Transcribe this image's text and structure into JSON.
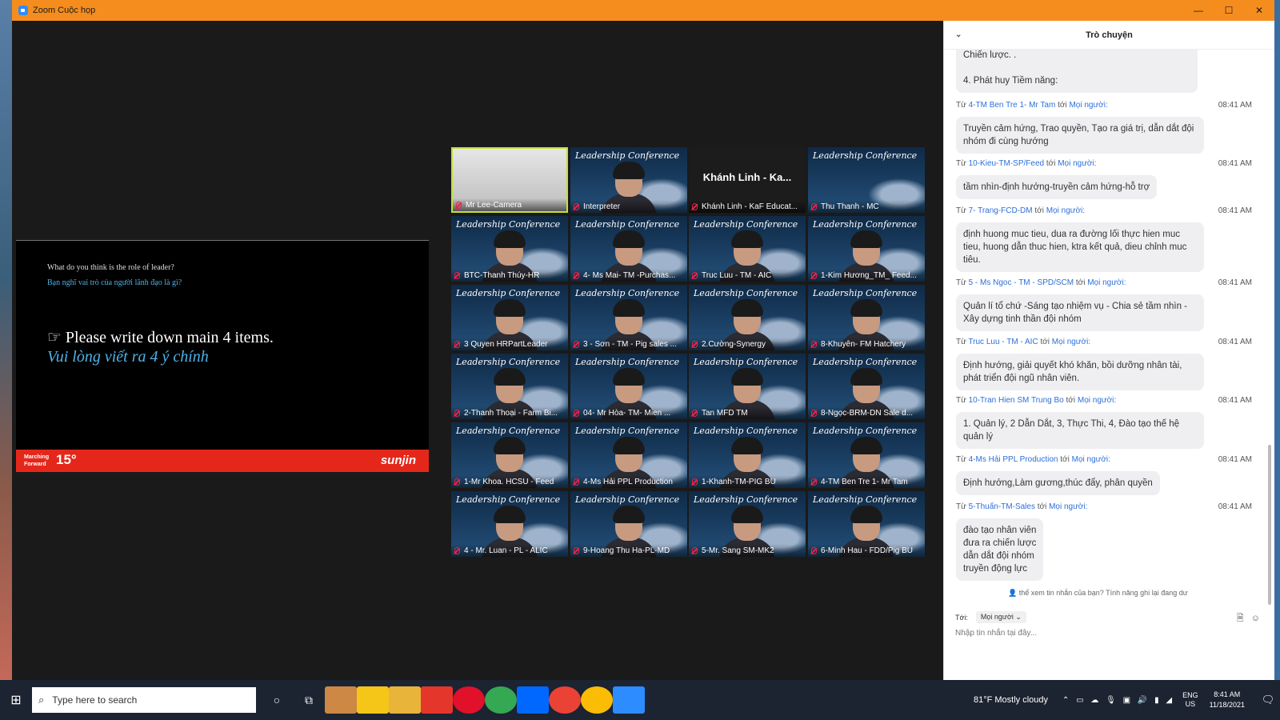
{
  "window": {
    "title": "Zoom Cuộc họp",
    "controls": [
      "—",
      "☐",
      "✕"
    ]
  },
  "slide": {
    "question_en": "What do you think is the role of leader?",
    "question_vi": "Bạn nghĩ vai trò của người lãnh đạo là gì?",
    "instruction_en": "☞ Please write down main 4 items.",
    "instruction_vi": "Vui lòng viết ra 4 ý chính",
    "footer_left": "Marching Forward",
    "footer_num": "15°",
    "footer_brand": "sunjin"
  },
  "tile_caption": "Leadership Conference",
  "participants": [
    {
      "name": "Mr Lee-Camera",
      "type": "active"
    },
    {
      "name": "Interpreter",
      "type": "video"
    },
    {
      "name": "Khánh Linh - KaF Educat...",
      "type": "black",
      "center": "Khánh Linh - Ka..."
    },
    {
      "name": "Thu Thanh - MC",
      "type": "bg"
    },
    {
      "name": "BTC-Thanh Thúy-HR",
      "type": "video"
    },
    {
      "name": "4- Ms Mai- TM -Purchas...",
      "type": "video"
    },
    {
      "name": "Truc Luu - TM - AIC",
      "type": "video"
    },
    {
      "name": "1-Kim Hương_TM_ Feed...",
      "type": "video"
    },
    {
      "name": "3 Quyen HRPartLeader",
      "type": "video"
    },
    {
      "name": "3 - Sơn - TM - Pig sales ...",
      "type": "video"
    },
    {
      "name": "2.Cường-Synergy",
      "type": "video"
    },
    {
      "name": "8-Khuyên- FM Hatchery",
      "type": "video"
    },
    {
      "name": "2-Thanh Thoại - Farm Bi...",
      "type": "video"
    },
    {
      "name": "04- Mr Hòa- TM- Mien ...",
      "type": "video"
    },
    {
      "name": "Tan MFD TM",
      "type": "video"
    },
    {
      "name": "8-Ngọc-BRM-DN Sale d...",
      "type": "video"
    },
    {
      "name": "1-Mr Khoa. HCSU - Feed",
      "type": "video"
    },
    {
      "name": "4-Ms Hải PPL Production",
      "type": "video"
    },
    {
      "name": "1-Khanh-TM-PIG BU",
      "type": "video"
    },
    {
      "name": "4-TM Ben Tre 1- Mr Tam",
      "type": "video"
    },
    {
      "name": "4 - Mr. Luan - PL - ALIC",
      "type": "video"
    },
    {
      "name": "9-Hoang Thu Ha-PL-MD",
      "type": "video"
    },
    {
      "name": "5-Mr. Sang SM-MK2",
      "type": "video"
    },
    {
      "name": "6-Minh Hau - FDD/Pig BU",
      "type": "video"
    }
  ],
  "chat": {
    "title": "Trò chuyện",
    "prefix": "Từ",
    "to_word": "tới",
    "top_partial": [
      "Chiến lược. .",
      "4. Phát huy Tiềm năng:"
    ],
    "messages": [
      {
        "from": "4-TM Ben Tre 1- Mr Tam",
        "to": "Mọi người:",
        "time": "08:41 AM",
        "text": "Truyền cảm hứng, Trao quyền, Tạo ra giá trị, dẫn dắt đội nhóm đi cùng hướng"
      },
      {
        "from": "10-Kieu-TM-SP/Feed",
        "to": "Mọi người:",
        "time": "08:41 AM",
        "text": "tầm nhìn-định hướng-truyền cảm hứng-hỗ trợ"
      },
      {
        "from": "7- Trang-FCD-DM",
        "to": "Mọi người:",
        "time": "08:41 AM",
        "text": "định huong muc tieu, dua ra đường lối thực hien muc tieu, huong dẫn thuc hien, ktra kết quả, dieu chỉnh muc tiêu."
      },
      {
        "from": "5 - Ms Ngoc - TM - SPD/SCM",
        "to": "Mọi người:",
        "time": "08:41 AM",
        "text": "Quản lí tổ chứ -Sáng tạo nhiệm vụ - Chia sẻ tầm nhìn - Xây dựng tinh thần đội nhóm"
      },
      {
        "from": "Truc Luu - TM - AIC",
        "to": "Mọi người:",
        "time": "08:41 AM",
        "text": "Định hướng, giải quyết khó khăn, bồi dưỡng nhân tài, phát triển đội ngũ nhân viên."
      },
      {
        "from": "10-Tran Hien SM Trung Bo",
        "to": "Mọi người:",
        "time": "08:41 AM",
        "text": "1. Quản lý, 2 Dẫn Dắt, 3, Thực Thi, 4, Đào tạo thế hệ quản lý"
      },
      {
        "from": "4-Ms Hải PPL Production",
        "to": "Mọi người:",
        "time": "08:41 AM",
        "text": "Định hướng,Làm gương,thúc đẩy, phân quyền"
      },
      {
        "from": "5-Thuấn-TM-Sales",
        "to": "Mọi người:",
        "time": "08:41 AM",
        "text": "đào tạo nhân viên\nđưa ra chiến lược\ndẫn dắt đội nhóm\ntruyền động lực"
      }
    ],
    "notice": "thể xem tin nhắn của bạn? Tính năng ghi lại đang dư",
    "to_label": "Tới:",
    "to_value": "Mọi người",
    "input_placeholder": "Nhập tin nhắn tại đây..."
  },
  "taskbar": {
    "search_placeholder": "Type here to search",
    "weather": "81°F  Mostly cloudy",
    "lang1": "ENG",
    "lang2": "US",
    "time": "8:41 AM",
    "date": "11/18/2021"
  }
}
